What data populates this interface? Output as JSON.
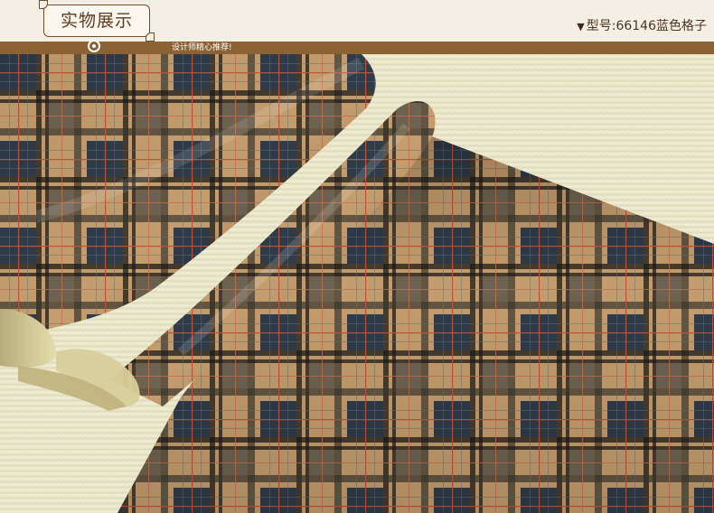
{
  "header": {
    "title": "实物展示",
    "model_label": "型号:66146蓝色格子",
    "tagline": "设计师精心推荐!"
  },
  "photo": {
    "subject": "plaid-wallpaper-rolls",
    "colors": {
      "carpet": "#e9e6c9",
      "navy": "#2d3b4c",
      "tan": "#c9a271",
      "black": "#1d1a16",
      "red_line": "#b8563c",
      "bar": "#8a6234"
    }
  }
}
